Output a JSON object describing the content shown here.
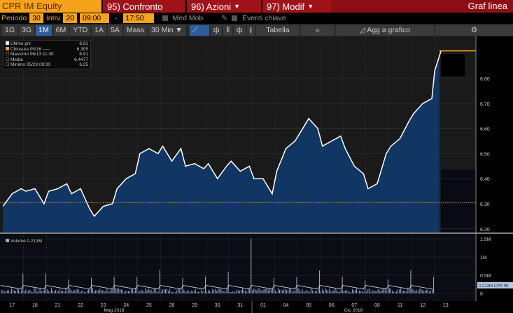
{
  "header": {
    "ticker": "CPR IM Equity",
    "compare": "95) Confronto",
    "actions": "96) Azioni",
    "modify": "97) Modif",
    "chart_type": "Graf linea"
  },
  "controls": {
    "period_label": "Periodo",
    "period_value": "30",
    "interval_label": "Intrv",
    "interval_value": "20",
    "start_time": "09:00",
    "dash": "-",
    "end_time": "17:50",
    "moving_avg": "Med Mob",
    "key_events": "Eventi chiave"
  },
  "toolbar": {
    "ranges": [
      "1G",
      "3G",
      "1M",
      "6M",
      "YTD",
      "1A",
      "5A",
      "Mass"
    ],
    "active_range": "1M",
    "bar_size": "30 Min ▼",
    "table": "Tabella",
    "collapse": "«",
    "add_to_chart": "Agg a grafico"
  },
  "legend": {
    "rows": [
      {
        "label": "Ultimo prz",
        "value": "6.91",
        "color": "#ffffff"
      },
      {
        "label": "Chiusura 05/16 -----",
        "value": "6.305",
        "color": "#f7a21b"
      },
      {
        "label": "Massimo 06/13 11:30",
        "value": "6.91",
        "color": ""
      },
      {
        "label": "Media",
        "value": "6.4477",
        "color": ""
      },
      {
        "label": "Minimo 05/23 09:30",
        "value": "6.25",
        "color": ""
      }
    ]
  },
  "volume_legend": "Volume 0.213M",
  "volume_tag": "0.213M CPR IM",
  "colors": {
    "line": "#ffffff",
    "fill": "#123a6b",
    "prev_close": "#f7a21b",
    "plot_bg": "#1a1a1a",
    "accent": "#f7a21b",
    "header": "#8b0f14"
  },
  "chart_data": [
    {
      "type": "area",
      "ylim": [
        6.2,
        6.91
      ],
      "yticks": [
        "6.20",
        "6.30",
        "6.40",
        "6.50",
        "6.60",
        "6.70",
        "6.80"
      ],
      "prev_close": 6.305,
      "last": 6.91,
      "days": [
        "17",
        "18",
        "21",
        "22",
        "23",
        "24",
        "25",
        "28",
        "29",
        "30",
        "31",
        "01",
        "04",
        "05",
        "06",
        "07",
        "08",
        "11",
        "12",
        "13"
      ],
      "months": [
        {
          "label": "Mag 2018"
        },
        {
          "label": "Giu 2018"
        }
      ],
      "prices": [
        [
          6.29,
          6.34,
          6.36
        ],
        [
          6.35,
          6.36,
          6.3
        ],
        [
          6.35,
          6.36,
          6.38
        ],
        [
          6.34,
          6.36,
          6.28
        ],
        [
          6.25,
          6.29,
          6.3
        ],
        [
          6.36,
          6.4,
          6.42
        ],
        [
          6.5,
          6.52,
          6.5
        ],
        [
          6.53,
          6.47,
          6.52
        ],
        [
          6.45,
          6.46,
          6.44
        ],
        [
          6.46,
          6.4,
          6.45
        ],
        [
          6.47,
          6.43,
          6.45
        ],
        [
          6.4,
          6.4,
          6.34
        ],
        [
          6.43,
          6.52,
          6.55
        ],
        [
          6.58,
          6.64,
          6.6
        ],
        [
          6.53,
          6.55,
          6.57
        ],
        [
          6.52,
          6.45,
          6.42
        ],
        [
          6.36,
          6.38,
          6.5
        ],
        [
          6.53,
          6.56,
          6.63
        ],
        [
          6.66,
          6.7,
          6.72
        ],
        [
          6.83,
          6.91
        ]
      ]
    },
    {
      "type": "bar",
      "name": "Volume",
      "ylim": [
        0,
        1.6
      ],
      "yticks": [
        "0",
        "0.5M",
        "1M",
        "1.5M"
      ],
      "daily_peak_M": [
        0.55,
        0.55,
        0.38,
        0.43,
        0.45,
        0.45,
        0.65,
        0.42,
        0.46,
        0.6,
        1.5,
        0.42,
        0.45,
        0.63,
        0.45,
        0.35,
        0.38,
        0.63,
        0.45
      ],
      "avg_M": 0.213
    }
  ]
}
